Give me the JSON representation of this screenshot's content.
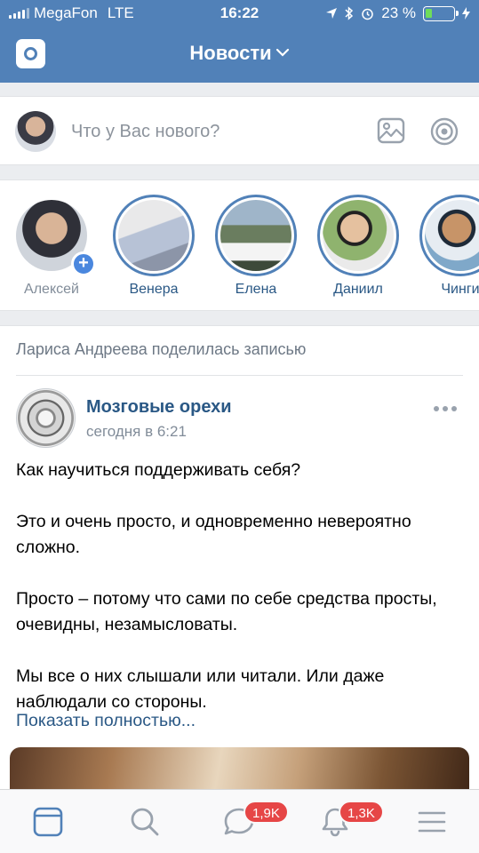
{
  "status_bar": {
    "carrier": "MegaFon",
    "network": "LTE",
    "time": "16:22",
    "battery": "23 %",
    "battery_level": 0.23,
    "icons": [
      "location-arrow-icon",
      "bluetooth-icon",
      "alarm-icon",
      "charging-bolt-icon"
    ]
  },
  "header": {
    "title": "Новости",
    "left_icon": "camera-icon",
    "title_icon": "chevron-down-icon"
  },
  "composer": {
    "placeholder": "Что у Вас нового?",
    "icons": [
      "photo-icon",
      "live-target-icon"
    ]
  },
  "stories": [
    {
      "name": "Алексей",
      "own": true
    },
    {
      "name": "Венера"
    },
    {
      "name": "Елена"
    },
    {
      "name": "Даниил"
    },
    {
      "name": "Чинги"
    }
  ],
  "post": {
    "shared_by": "Лариса Андреева поделилась записью",
    "group_name": "Мозговые орехи",
    "time": "сегодня в 6:21",
    "paragraphs": [
      "Как научиться поддерживать себя?",
      "Это и очень просто, и одновременно невероятно сложно.",
      "Просто – потому что сами по себе средства просты, очевидны, незамысловаты.",
      "Мы все о них слышали или читали. Или даже наблюдали со стороны."
    ],
    "show_more": "Показать полностью..."
  },
  "tabbar": {
    "tabs": [
      {
        "name": "news",
        "icon": "news-feed-icon"
      },
      {
        "name": "search",
        "icon": "search-icon"
      },
      {
        "name": "messages",
        "icon": "message-bubble-icon",
        "badge": "1,9K"
      },
      {
        "name": "notifications",
        "icon": "bell-icon",
        "badge": "1,3K"
      },
      {
        "name": "menu",
        "icon": "hamburger-menu-icon"
      }
    ],
    "accent": "#5181b8",
    "badge_color": "#e64646"
  },
  "colors": {
    "header_bg": "#5181b8",
    "link": "#2a5885",
    "page_bg": "#ebedf0"
  }
}
